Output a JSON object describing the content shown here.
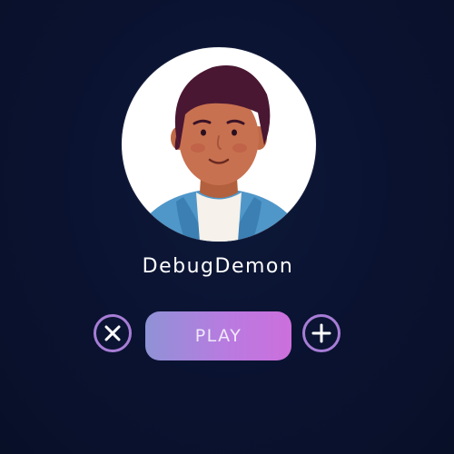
{
  "profile": {
    "username": "DebugDemon"
  },
  "actions": {
    "play_label": "PLAY",
    "dismiss_icon": "close-icon",
    "add_icon": "plus-icon"
  },
  "colors": {
    "background": "#0b1433",
    "accent_ring": "#a77dd6",
    "play_gradient_start": "#8f92d6",
    "play_gradient_end": "#cc6fdc",
    "text": "#ffffff"
  }
}
